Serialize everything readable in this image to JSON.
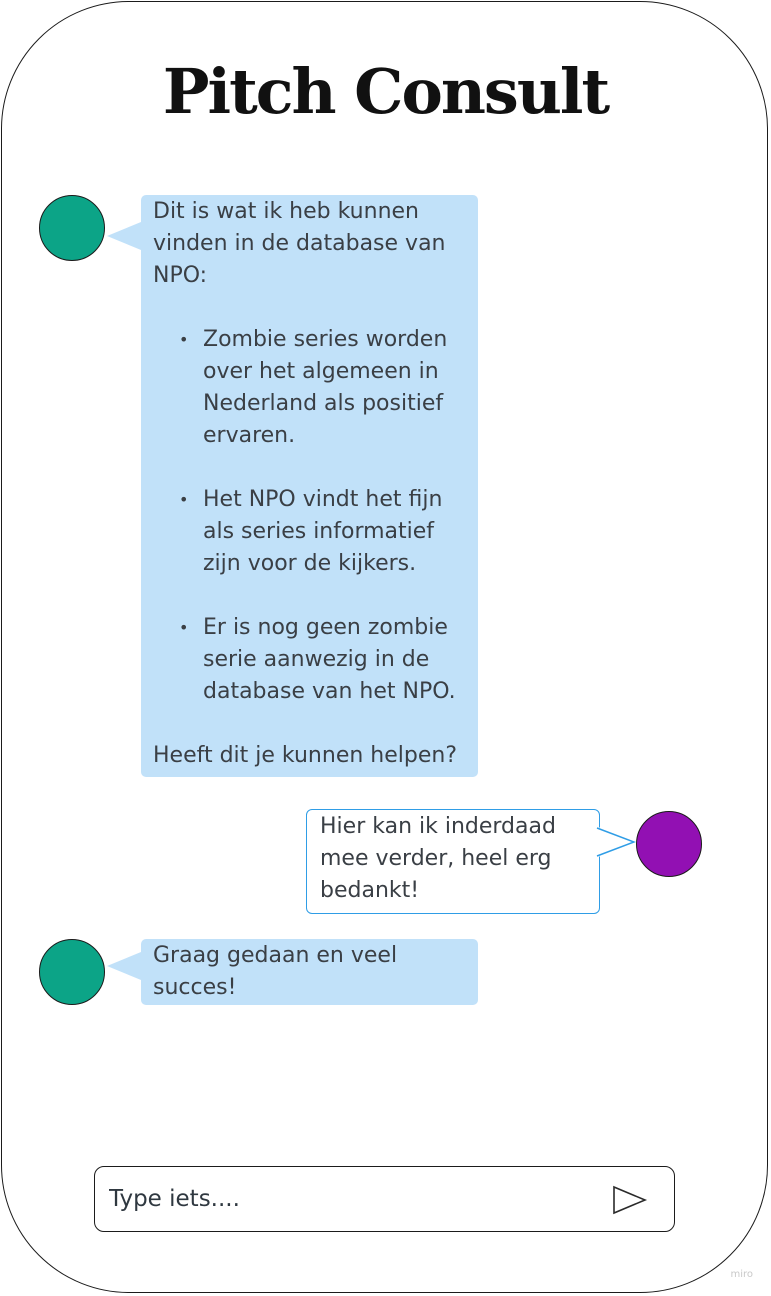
{
  "app": {
    "title": "Pitch Consult"
  },
  "conversation": {
    "messages": [
      {
        "sender": "bot",
        "intro": "Dit is wat ik heb kunnen vinden in de database van NPO:",
        "bullets": [
          "Zombie series worden over het algemeen in Nederland als positief ervaren.",
          "Het NPO vindt het fijn als series informatief zijn voor de kijkers.",
          "Er is nog geen zombie serie aanwezig in de database van het NPO."
        ],
        "outro": "Heeft dit je kunnen helpen?"
      },
      {
        "sender": "user",
        "text": "Hier kan ik inderdaad mee verder, heel erg bedankt!"
      },
      {
        "sender": "bot",
        "text": "Graag gedaan en veel succes!"
      }
    ]
  },
  "composer": {
    "placeholder": "Type iets...."
  },
  "icons": {
    "send": "send-triangle-icon"
  },
  "colors": {
    "bot_avatar": "#0ca487",
    "user_avatar": "#9210b3",
    "bot_bubble": "#c1e1f9",
    "user_bubble_border": "#2f9de6"
  },
  "watermark": "miro"
}
